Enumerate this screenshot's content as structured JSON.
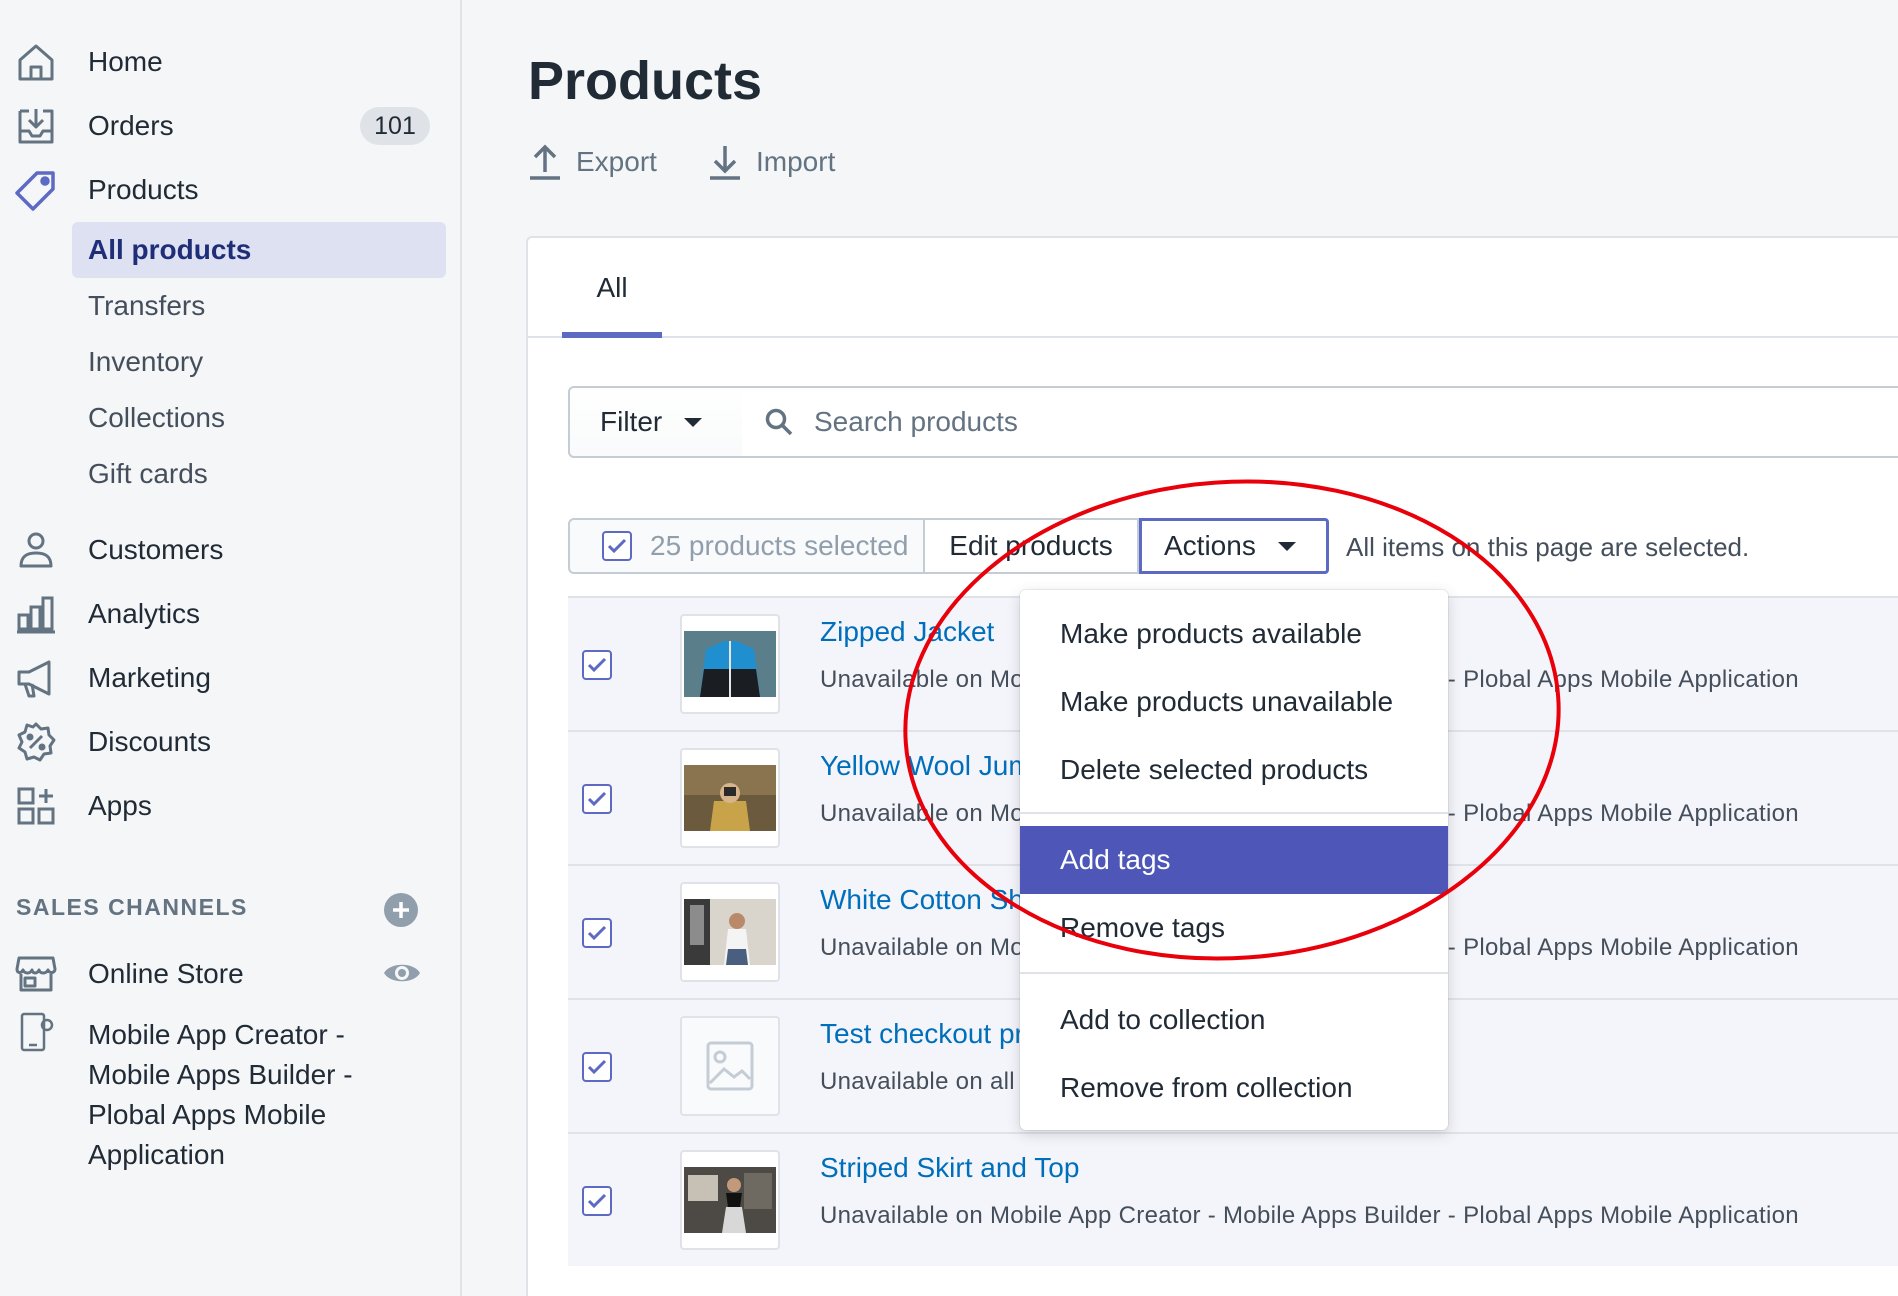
{
  "sidebar": {
    "items": [
      {
        "label": "Home",
        "icon": "home-icon"
      },
      {
        "label": "Orders",
        "icon": "orders-icon",
        "badge": "101"
      },
      {
        "label": "Products",
        "icon": "tag-icon"
      }
    ],
    "sub_items": [
      "All products",
      "Transfers",
      "Inventory",
      "Collections",
      "Gift cards"
    ],
    "items2": [
      {
        "label": "Customers",
        "icon": "customers-icon"
      },
      {
        "label": "Analytics",
        "icon": "analytics-icon"
      },
      {
        "label": "Marketing",
        "icon": "marketing-icon"
      },
      {
        "label": "Discounts",
        "icon": "discounts-icon"
      },
      {
        "label": "Apps",
        "icon": "apps-icon"
      }
    ],
    "sales_channels_title": "SALES CHANNELS",
    "channels": [
      {
        "label": "Online Store",
        "icon": "store-icon"
      },
      {
        "label": "Mobile App Creator - Mobile Apps Builder - Plobal Apps Mobile Application",
        "icon": "mobile-app-icon"
      }
    ]
  },
  "page": {
    "title": "Products",
    "export_label": "Export",
    "import_label": "Import"
  },
  "tabs": [
    {
      "label": "All"
    }
  ],
  "filter": {
    "label": "Filter",
    "search_placeholder": "Search products"
  },
  "bulk": {
    "selected_label": "25 products selected",
    "edit_label": "Edit products",
    "actions_label": "Actions",
    "note": "All items on this page are selected."
  },
  "products": [
    {
      "name": "Zipped Jacket",
      "status": "Unavailable on Mobile App Creator - Mobile Apps Builder - Plobal Apps Mobile Application"
    },
    {
      "name": "Yellow Wool Jumper",
      "status": "Unavailable on Mobile App Creator - Mobile Apps Builder - Plobal Apps Mobile Application"
    },
    {
      "name": "White Cotton Shirt",
      "status": "Unavailable on Mobile App Creator - Mobile Apps Builder - Plobal Apps Mobile Application"
    },
    {
      "name": "Test checkout product",
      "status": "Unavailable on all channels"
    },
    {
      "name": "Striped Skirt and Top",
      "status": "Unavailable on Mobile App Creator - Mobile Apps Builder - Plobal Apps Mobile Application"
    }
  ],
  "actions_menu": {
    "group1": [
      "Make products available",
      "Make products unavailable",
      "Delete selected products"
    ],
    "group2": [
      "Add tags",
      "Remove tags"
    ],
    "group3": [
      "Add to collection",
      "Remove from collection"
    ],
    "highlighted": "Add tags"
  },
  "colors": {
    "accent": "#5c6ac4",
    "menu_highlight": "#4e57b8",
    "link": "#006fbb",
    "annotation": "#e8000b"
  }
}
